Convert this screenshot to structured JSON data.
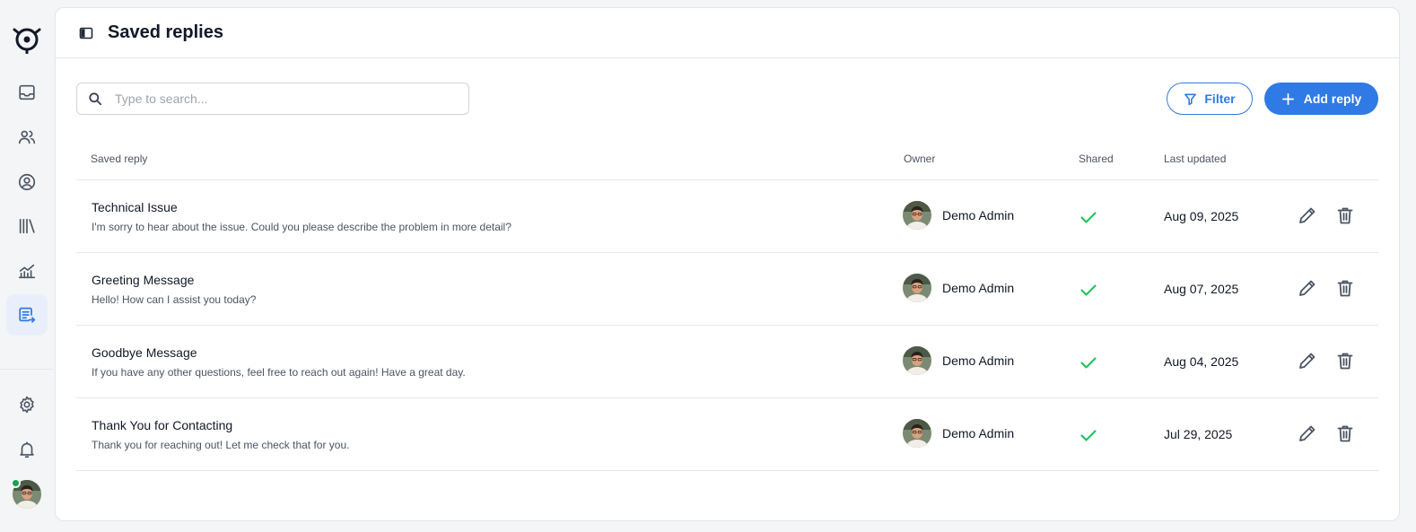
{
  "page": {
    "title": "Saved replies"
  },
  "sidebar": {
    "items": [
      {
        "icon": "inbox-icon",
        "name": "Inbox"
      },
      {
        "icon": "users-icon",
        "name": "Teams"
      },
      {
        "icon": "user-circle-icon",
        "name": "Contacts"
      },
      {
        "icon": "library-icon",
        "name": "Knowledge base"
      },
      {
        "icon": "analytics-icon",
        "name": "Reports"
      },
      {
        "icon": "saved-replies-icon",
        "name": "Saved replies",
        "active": true
      }
    ],
    "bottom_items": [
      {
        "icon": "gear-icon",
        "name": "Settings"
      },
      {
        "icon": "bell-icon",
        "name": "Notifications"
      }
    ],
    "user_status": "online"
  },
  "toolbar": {
    "search_placeholder": "Type to search...",
    "search_value": "",
    "filter_label": "Filter",
    "add_label": "Add reply"
  },
  "table": {
    "columns": {
      "name": "Saved reply",
      "owner": "Owner",
      "shared": "Shared",
      "updated": "Last updated"
    },
    "rows": [
      {
        "title": "Technical Issue",
        "body": "I'm sorry to hear about the issue. Could you please describe the problem in more detail?",
        "owner": "Demo Admin",
        "shared": true,
        "updated": "Aug 09, 2025"
      },
      {
        "title": "Greeting Message",
        "body": "Hello! How can I assist you today?",
        "owner": "Demo Admin",
        "shared": true,
        "updated": "Aug 07, 2025"
      },
      {
        "title": "Goodbye Message",
        "body": "If you have any other questions, feel free to reach out again! Have a great day.",
        "owner": "Demo Admin",
        "shared": true,
        "updated": "Aug 04, 2025"
      },
      {
        "title": "Thank You for Contacting",
        "body": "Thank you for reaching out! Let me check that for you.",
        "owner": "Demo Admin",
        "shared": true,
        "updated": "Jul 29, 2025"
      }
    ]
  },
  "colors": {
    "accent": "#2f7ae5",
    "accent_soft": "#e8effb",
    "check": "#22c55e",
    "online": "#16a34a"
  }
}
